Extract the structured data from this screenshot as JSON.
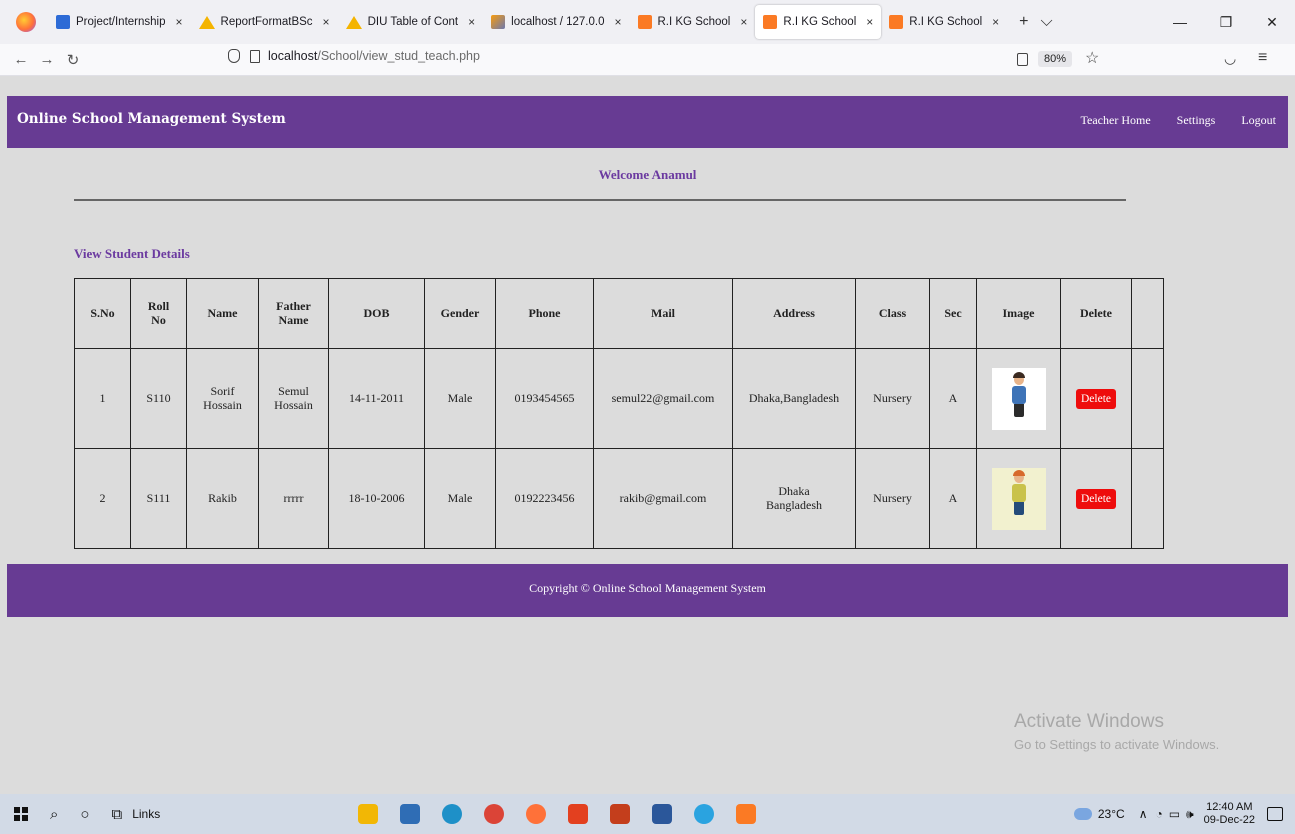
{
  "browser": {
    "tabs": [
      {
        "label": "Project/Internship",
        "close": "×",
        "favicon": "blue-board-icon",
        "active": false
      },
      {
        "label": "ReportFormatBSc",
        "close": "×",
        "favicon": "google-drive-icon",
        "active": false
      },
      {
        "label": "DIU Table of Cont",
        "close": "×",
        "favicon": "google-drive-icon",
        "active": false
      },
      {
        "label": "localhost / 127.0.0",
        "close": "×",
        "favicon": "phpmyadmin-icon",
        "active": false
      },
      {
        "label": "R.I KG School",
        "close": "×",
        "favicon": "xampp-icon",
        "active": false
      },
      {
        "label": "R.I KG School",
        "close": "×",
        "favicon": "xampp-icon",
        "active": true
      },
      {
        "label": "R.I KG School",
        "close": "×",
        "favicon": "xampp-icon",
        "active": false
      }
    ],
    "url_host": "localhost",
    "url_path": "/School/view_stud_teach.php",
    "zoom": "80%"
  },
  "site": {
    "brand": "Online School Management System",
    "nav": [
      "Teacher Home",
      "Settings",
      "Logout"
    ],
    "welcome": "Welcome Anamul",
    "section_title": "View Student Details",
    "footer": "Copyright © Online School Management System"
  },
  "table": {
    "headers": [
      "S.No",
      "Roll No",
      "Name",
      "Father Name",
      "DOB",
      "Gender",
      "Phone",
      "Mail",
      "Address",
      "Class",
      "Sec",
      "Image",
      "Delete",
      ""
    ],
    "rows": [
      {
        "sno": "1",
        "roll": "S110",
        "name": "Sorif Hossain",
        "father": "Semul Hossain",
        "dob": "14-11-2011",
        "gender": "Male",
        "phone": "0193454565",
        "mail": "semul22@gmail.com",
        "address": "Dhaka,Bangladesh",
        "class": "Nursery",
        "sec": "A",
        "delete": "Delete"
      },
      {
        "sno": "2",
        "roll": "S111",
        "name": "Rakib",
        "father": "rrrrr",
        "dob": "18-10-2006",
        "gender": "Male",
        "phone": "0192223456",
        "mail": "rakib@gmail.com",
        "address": "Dhaka Bangladesh",
        "class": "Nursery",
        "sec": "A",
        "delete": "Delete"
      }
    ]
  },
  "watermark": {
    "title": "Activate Windows",
    "subtitle": "Go to Settings to activate Windows."
  },
  "taskbar": {
    "links_label": "Links",
    "temperature": "23°C",
    "time": "12:40 AM",
    "date": "09-Dec-22"
  },
  "colors": {
    "header_purple": "#673b93",
    "accent_text": "#6b3aa0",
    "delete_red": "#ee0c0c",
    "page_bg": "#dcdcdc"
  }
}
